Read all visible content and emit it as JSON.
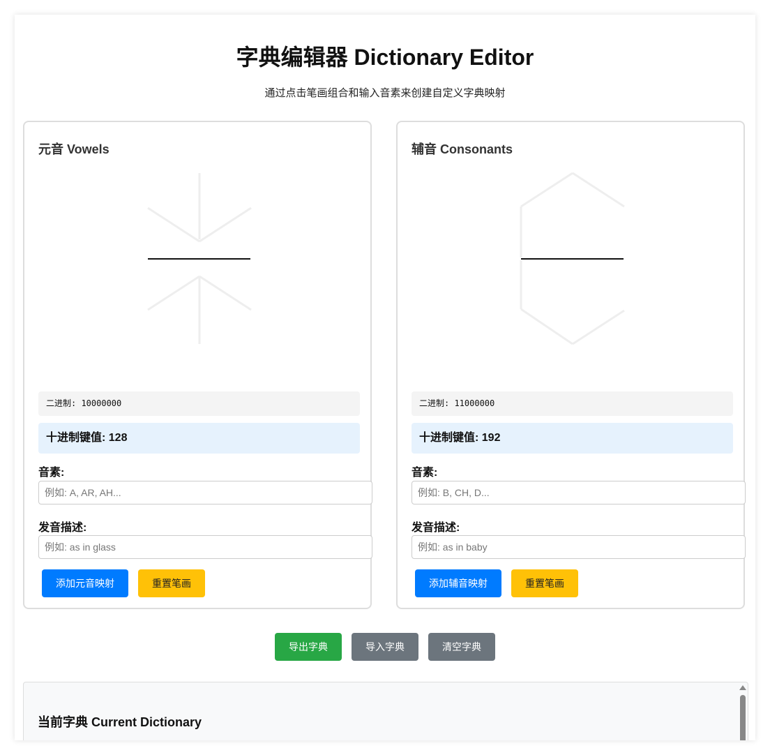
{
  "header": {
    "title": "字典编辑器 Dictionary Editor",
    "subtitle": "通过点击笔画组合和输入音素来创建自定义字典映射"
  },
  "vowels": {
    "title": "元音 Vowels",
    "binary_label": "二进制: 10000000",
    "decimal_label": "十进制键值: 128",
    "phoneme_label": "音素:",
    "phoneme_value": "",
    "phoneme_placeholder": "例如: A, AR, AH...",
    "pron_label": "发音描述:",
    "pron_value": "",
    "pron_placeholder": "例如: as in glass",
    "add_button": "添加元音映射",
    "reset_button": "重置笔画"
  },
  "consonants": {
    "title": "辅音 Consonants",
    "binary_label": "二进制: 11000000",
    "decimal_label": "十进制键值: 192",
    "phoneme_label": "音素:",
    "phoneme_value": "",
    "phoneme_placeholder": "例如: B, CH, D...",
    "pron_label": "发音描述:",
    "pron_value": "",
    "pron_placeholder": "例如: as in baby",
    "add_button": "添加辅音映射",
    "reset_button": "重置笔画"
  },
  "actions": {
    "export_button": "导出字典",
    "import_button": "导入字典",
    "clear_button": "清空字典"
  },
  "dictionary": {
    "title": "当前字典 Current Dictionary"
  },
  "colors": {
    "stroke_active": "#111111",
    "stroke_inactive": "#eeeeee",
    "primary": "#007bff",
    "warning": "#ffc107",
    "success": "#28a745",
    "secondary": "#6c757d"
  }
}
